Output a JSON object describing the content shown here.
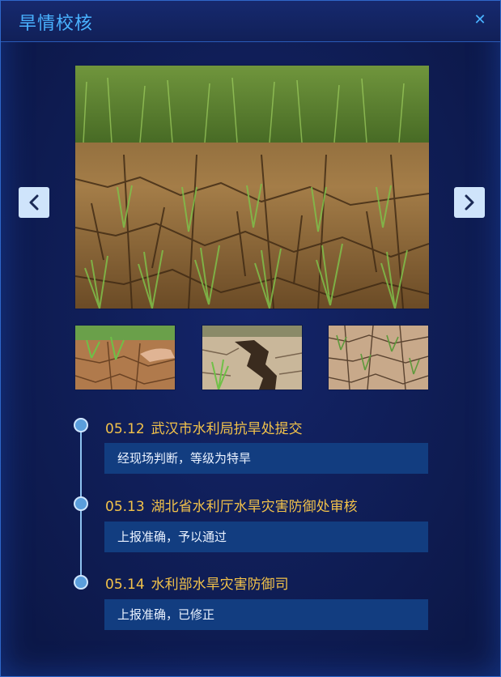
{
  "header": {
    "title": "旱情校核",
    "close_icon": "close-icon"
  },
  "gallery": {
    "prev_icon": "chevron-left-icon",
    "next_icon": "chevron-right-icon",
    "selected_index": 0
  },
  "timeline": [
    {
      "date": "05.12",
      "org": "武汉市水利局抗旱处提交",
      "comment": "经现场判断，等级为特旱"
    },
    {
      "date": "05.13",
      "org": "湖北省水利厅水旱灾害防御处审核",
      "comment": "上报准确，予以通过"
    },
    {
      "date": "05.14",
      "org": "水利部水旱灾害防御司",
      "comment": "上报准确，已修正"
    }
  ],
  "colors": {
    "accent": "#49b2ff",
    "date_text": "#f2c24a",
    "panel_bg": "#0f1d55",
    "comment_bg": "#123d80"
  }
}
